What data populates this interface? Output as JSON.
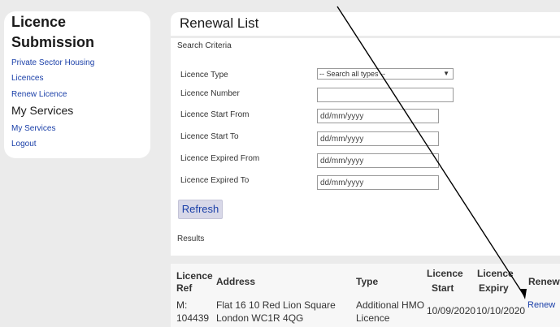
{
  "sidebar": {
    "title_line1": "Licence",
    "title_line2": "Submission",
    "links": [
      "Private Sector Housing",
      "Licences",
      "Renew Licence"
    ],
    "section_title": "My Services",
    "section_links": [
      "My Services",
      "Logout"
    ]
  },
  "page": {
    "title": "Renewal List",
    "search_criteria_title": "Search Criteria",
    "results_title": "Results",
    "refresh_label": "Refresh"
  },
  "form": {
    "licence_type_label": "Licence Type",
    "licence_type_value": "-- Search all types --",
    "licence_number_label": "Licence Number",
    "licence_number_value": "",
    "start_from_label": "Licence Start From",
    "start_to_label": "Licence Start To",
    "expired_from_label": "Licence Expired From",
    "expired_to_label": "Licence Expired To",
    "date_placeholder": "dd/mm/yyyy"
  },
  "table": {
    "headers": {
      "ref_1": "Licence",
      "ref_2": "Ref",
      "address": "Address",
      "type": "Type",
      "start_1": "Licence",
      "start_2": "Start",
      "expiry_1": "Licence",
      "expiry_2": "Expiry",
      "renew": "Renew"
    },
    "row": {
      "ref_1": "M:",
      "ref_2": "104439",
      "address_1": "Flat 16 10 Red Lion Square",
      "address_2": "London WC1R 4QG",
      "type_1": "Additional HMO",
      "type_2": "Licence",
      "start": "10/09/2020",
      "expiry": "10/10/2020",
      "renew": "Renew"
    }
  },
  "annotation": {
    "arrow_color": "#000000"
  }
}
